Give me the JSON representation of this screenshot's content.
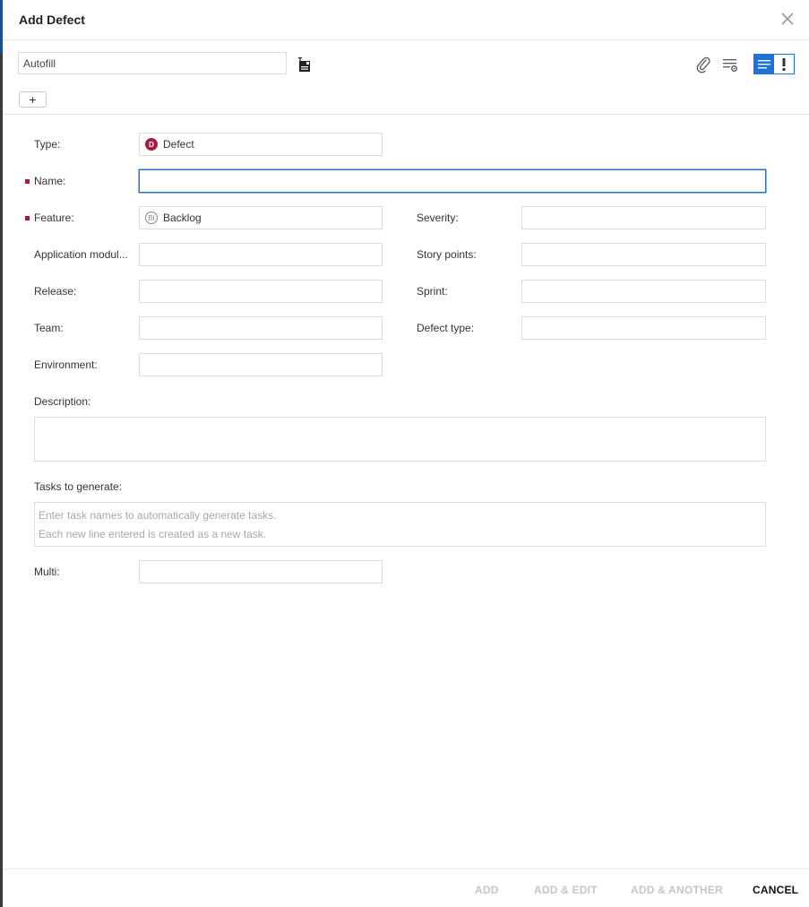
{
  "dialog": {
    "title": "Add Defect",
    "close_icon": "close-icon"
  },
  "toolbar": {
    "autofill_value": "Autofill",
    "add_label": "+",
    "icons": [
      "save-template-icon",
      "attachment-icon",
      "field-settings-icon",
      "list-view-icon",
      "alert-view-icon"
    ],
    "accent_color": "#1f73d8"
  },
  "form": {
    "type_label": "Type:",
    "type_value": "Defect",
    "type_badge": "D",
    "name_label": "Name:",
    "name_value": "",
    "feature_label": "Feature:",
    "feature_value": "Backlog",
    "feature_badge": "BI",
    "severity_label": "Severity:",
    "app_module_label": "Application modul...",
    "story_points_label": "Story points:",
    "release_label": "Release:",
    "sprint_label": "Sprint:",
    "team_label": "Team:",
    "defect_type_label": "Defect type:",
    "environment_label": "Environment:",
    "description_label": "Description:",
    "tasks_label": "Tasks to generate:",
    "tasks_placeholder_line1": "Enter task names to automatically generate tasks.",
    "tasks_placeholder_line2": "Each new line entered is created as a new task.",
    "multi_label": "Multi:",
    "required_color": "#a51c40"
  },
  "footer": {
    "add": "ADD",
    "add_edit": "ADD & EDIT",
    "add_another": "ADD & ANOTHER",
    "cancel": "CANCEL"
  }
}
